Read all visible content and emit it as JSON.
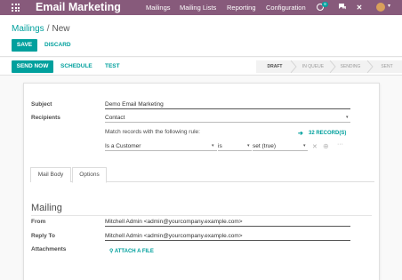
{
  "topbar": {
    "app_title": "Email Marketing",
    "menu": [
      "Mailings",
      "Mailing Lists",
      "Reporting",
      "Configuration"
    ],
    "activity_badge": "8",
    "icons": [
      "apps-grid-icon",
      "activity-clock-icon",
      "chat-icon",
      "close-icon",
      "user-avatar"
    ],
    "color": "#875a7b"
  },
  "breadcrumb": {
    "parent": "Mailings",
    "separator": "/",
    "current": "New"
  },
  "actions": {
    "save": "SAVE",
    "discard": "DISCARD"
  },
  "statusbar": {
    "send_now": "SEND NOW",
    "schedule": "SCHEDULE",
    "test": "TEST",
    "stages": [
      "DRAFT",
      "IN QUEUE",
      "SENDING",
      "SENT"
    ],
    "active_stage": "DRAFT"
  },
  "form": {
    "subject_label": "Subject",
    "subject_value": "Demo Email Marketing",
    "recipients_label": "Recipients",
    "recipients_value": "Contact",
    "rule_text": "Match records with the following rule:",
    "records_count": "32 RECORD(S)",
    "domain": {
      "field": "Is a Customer",
      "operator": "is",
      "value": "set (true)"
    },
    "tabs": [
      "Mail Body",
      "Options"
    ],
    "active_tab": "Options"
  },
  "mailing": {
    "title": "Mailing",
    "from_label": "From",
    "from_value": "Mitchell Admin <admin@yourcompany.example.com>",
    "reply_label": "Reply To",
    "reply_value": "Mitchell Admin <admin@yourcompany.example.com>",
    "attachments_label": "Attachments",
    "attach_button": "ATTACH A FILE"
  },
  "accent_color": "#00a09d"
}
